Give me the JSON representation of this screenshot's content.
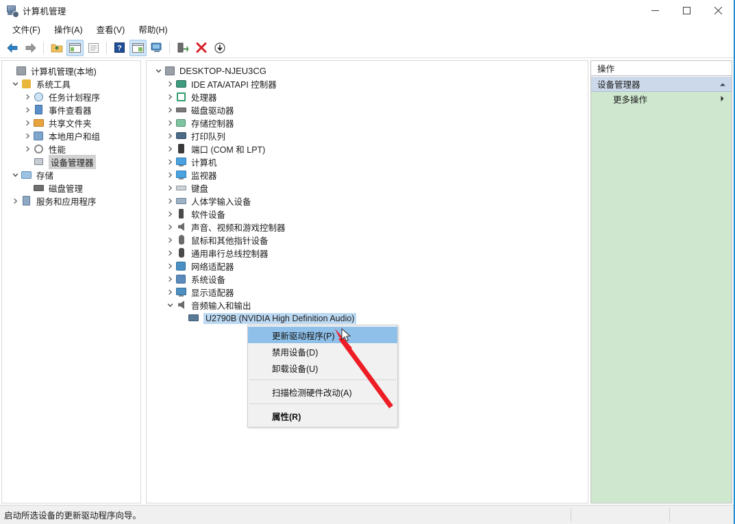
{
  "window": {
    "title": "计算机管理",
    "icon": "computer-management-icon",
    "controls": {
      "minimize": "—",
      "maximize": "□",
      "close": "✕"
    }
  },
  "menubar": {
    "items": [
      {
        "label": "文件(F)",
        "name": "menu-file"
      },
      {
        "label": "操作(A)",
        "name": "menu-action"
      },
      {
        "label": "查看(V)",
        "name": "menu-view"
      },
      {
        "label": "帮助(H)",
        "name": "menu-help"
      }
    ]
  },
  "toolbar": {
    "buttons": [
      {
        "name": "back-icon",
        "tip": "后退"
      },
      {
        "name": "forward-icon",
        "tip": "前进"
      },
      {
        "name": "up-folder-icon",
        "tip": "向上"
      },
      {
        "name": "show-console-tree-icon",
        "tip": "显示/隐藏控制台树",
        "active": true
      },
      {
        "name": "properties-icon",
        "tip": "属性"
      },
      {
        "name": "help-icon",
        "tip": "帮助"
      },
      {
        "name": "show-action-pane-icon",
        "tip": "显示/隐藏操作窗格",
        "active": true
      },
      {
        "name": "scan-hardware-icon",
        "tip": "扫描检测硬件改动"
      },
      {
        "name": "update-driver-icon",
        "tip": "更新驱动程序"
      },
      {
        "name": "disable-device-icon",
        "tip": "禁用设备"
      },
      {
        "name": "uninstall-device-icon",
        "tip": "卸载设备"
      }
    ]
  },
  "console_tree": {
    "root": {
      "label": "计算机管理(本地)",
      "icon": "computer-management-icon",
      "indent": 0,
      "twist": "none"
    },
    "items": [
      {
        "label": "系统工具",
        "icon": "tools-icon",
        "indent": 1,
        "twist": "expanded",
        "selected": false
      },
      {
        "label": "任务计划程序",
        "icon": "clock-icon",
        "indent": 2,
        "twist": "collapsed",
        "selected": false
      },
      {
        "label": "事件查看器",
        "icon": "event-viewer-icon",
        "indent": 2,
        "twist": "collapsed",
        "selected": false
      },
      {
        "label": "共享文件夹",
        "icon": "shared-folder-icon",
        "indent": 2,
        "twist": "collapsed",
        "selected": false
      },
      {
        "label": "本地用户和组",
        "icon": "users-icon",
        "indent": 2,
        "twist": "collapsed",
        "selected": false
      },
      {
        "label": "性能",
        "icon": "performance-icon",
        "indent": 2,
        "twist": "collapsed",
        "selected": false
      },
      {
        "label": "设备管理器",
        "icon": "device-manager-icon",
        "indent": 2,
        "twist": "none",
        "selected": true
      },
      {
        "label": "存储",
        "icon": "storage-icon",
        "indent": 1,
        "twist": "expanded",
        "selected": false
      },
      {
        "label": "磁盘管理",
        "icon": "disk-management-icon",
        "indent": 2,
        "twist": "none",
        "selected": false
      },
      {
        "label": "服务和应用程序",
        "icon": "services-icon",
        "indent": 1,
        "twist": "collapsed",
        "selected": false
      }
    ]
  },
  "device_tree": {
    "root": {
      "label": "DESKTOP-NJEU3CG",
      "icon": "computer-root-icon",
      "twist": "expanded"
    },
    "items": [
      {
        "label": "IDE ATA/ATAPI 控制器",
        "icon": "ide-controller-icon",
        "twist": "collapsed"
      },
      {
        "label": "处理器",
        "icon": "processor-icon",
        "twist": "collapsed"
      },
      {
        "label": "磁盘驱动器",
        "icon": "disk-drive-icon",
        "twist": "collapsed"
      },
      {
        "label": "存储控制器",
        "icon": "storage-controller-icon",
        "twist": "collapsed"
      },
      {
        "label": "打印队列",
        "icon": "print-queue-icon",
        "twist": "collapsed"
      },
      {
        "label": "端口 (COM 和 LPT)",
        "icon": "port-icon",
        "twist": "collapsed"
      },
      {
        "label": "计算机",
        "icon": "computer-icon",
        "twist": "collapsed"
      },
      {
        "label": "监视器",
        "icon": "monitor-icon",
        "twist": "collapsed"
      },
      {
        "label": "键盘",
        "icon": "keyboard-icon",
        "twist": "collapsed"
      },
      {
        "label": "人体学输入设备",
        "icon": "hid-icon",
        "twist": "collapsed"
      },
      {
        "label": "软件设备",
        "icon": "software-device-icon",
        "twist": "collapsed"
      },
      {
        "label": "声音、视频和游戏控制器",
        "icon": "sound-controller-icon",
        "twist": "collapsed"
      },
      {
        "label": "鼠标和其他指针设备",
        "icon": "mouse-icon",
        "twist": "collapsed"
      },
      {
        "label": "通用串行总线控制器",
        "icon": "usb-controller-icon",
        "twist": "collapsed"
      },
      {
        "label": "网络适配器",
        "icon": "network-adapter-icon",
        "twist": "collapsed"
      },
      {
        "label": "系统设备",
        "icon": "system-device-icon",
        "twist": "collapsed"
      },
      {
        "label": "显示适配器",
        "icon": "display-adapter-icon",
        "twist": "collapsed"
      },
      {
        "label": "音频输入和输出",
        "icon": "audio-io-icon",
        "twist": "expanded"
      }
    ],
    "selected_device": {
      "label": "U2790B (NVIDIA High Definition Audio)",
      "icon": "audio-device-icon",
      "selected": true
    }
  },
  "context_menu": {
    "items": [
      {
        "label": "更新驱动程序(P)",
        "name": "ctx-update-driver",
        "highlighted": true,
        "bold": false,
        "separator_after": false
      },
      {
        "label": "禁用设备(D)",
        "name": "ctx-disable-device",
        "highlighted": false,
        "bold": false,
        "separator_after": false
      },
      {
        "label": "卸载设备(U)",
        "name": "ctx-uninstall-device",
        "highlighted": false,
        "bold": false,
        "separator_after": true
      },
      {
        "label": "扫描检测硬件改动(A)",
        "name": "ctx-scan-hardware",
        "highlighted": false,
        "bold": false,
        "separator_after": true
      },
      {
        "label": "属性(R)",
        "name": "ctx-properties",
        "highlighted": false,
        "bold": true,
        "separator_after": false
      }
    ]
  },
  "actions_pane": {
    "header": "操作",
    "section": {
      "label": "设备管理器",
      "collapse_icon": "chevron-up-icon"
    },
    "rows": [
      {
        "label": "更多操作",
        "submenu_icon": "chevron-right-icon"
      }
    ]
  },
  "statusbar": {
    "text": "启动所选设备的更新驱动程序向导。"
  },
  "colors": {
    "accent_blue": "#8fc0e9",
    "selection_blue": "#bcd9f2",
    "actions_green": "#cfe7cf",
    "actions_section": "#ccd9ea",
    "annotation_red": "#ee1c25",
    "toolbar_active": "#cfe4f7",
    "window_border": "#1e8bd4"
  }
}
